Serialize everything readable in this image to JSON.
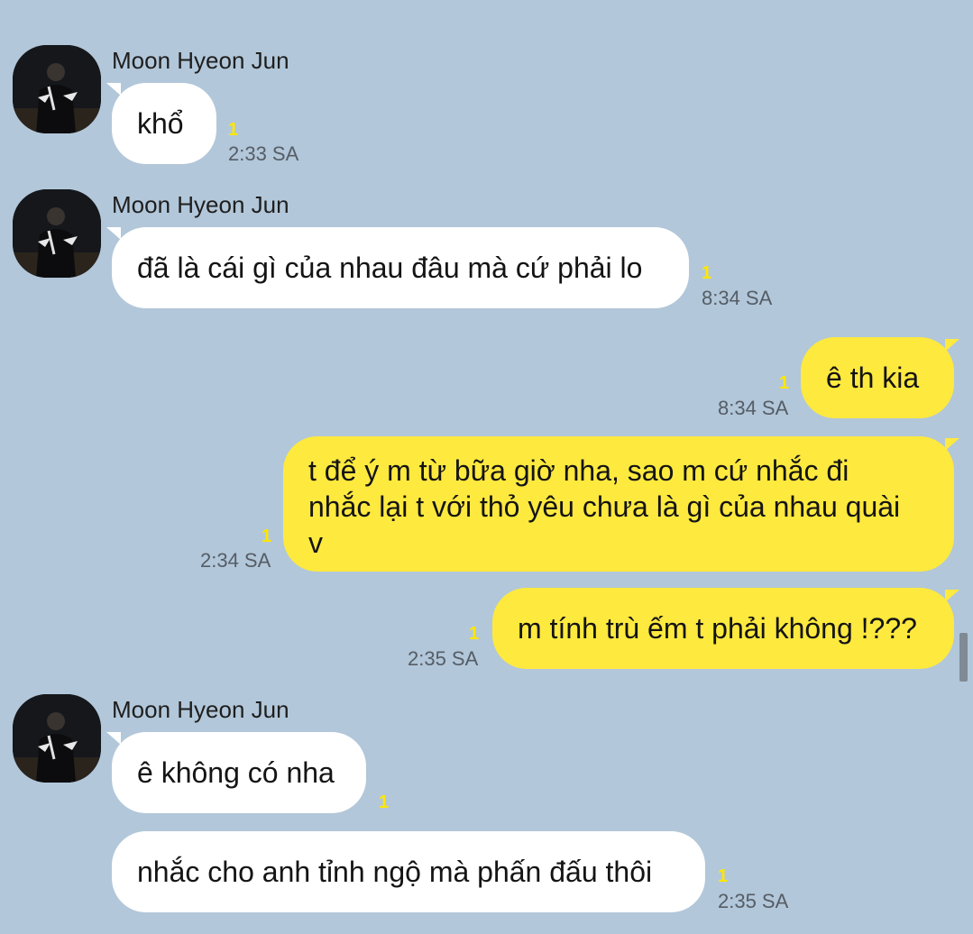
{
  "chat": {
    "contact_name": "Moon Hyeon Jun",
    "messages": [
      {
        "side": "in",
        "text": "khổ",
        "unread": "1",
        "time": "2:33 SA"
      },
      {
        "side": "in",
        "text": "đã là cái gì của nhau đâu mà cứ phải lo",
        "unread": "1",
        "time": "8:34 SA"
      },
      {
        "side": "out",
        "text": "ê th kia",
        "unread": "1",
        "time": "8:34 SA"
      },
      {
        "side": "out",
        "lines": [
          "t để ý m từ bữa giờ nha, sao m cứ nhắc đi",
          "nhắc lại t với thỏ yêu chưa là gì của nhau quài",
          "v"
        ],
        "unread": "1",
        "time": "2:34 SA"
      },
      {
        "side": "out",
        "text": "m tính trù ếm t phải không !???",
        "unread": "1",
        "time": "2:35 SA"
      },
      {
        "side": "in",
        "text": "ê không có nha",
        "unread": "1",
        "time": ""
      },
      {
        "side": "in",
        "text": "nhắc cho anh tỉnh ngộ mà phấn đấu thôi",
        "unread": "1",
        "time": "2:35 SA"
      }
    ]
  },
  "colors": {
    "background": "#b2c7d9",
    "incoming_bubble": "#ffffff",
    "outgoing_bubble": "#fee93f",
    "unread_count": "#ffe600",
    "timestamp": "#555d66"
  },
  "icons": {
    "avatar": "profile-photo"
  }
}
